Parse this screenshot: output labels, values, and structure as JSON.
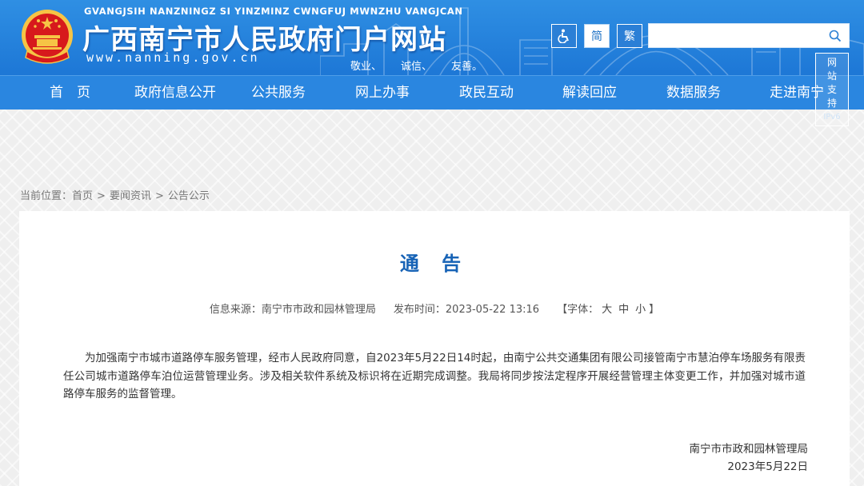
{
  "header": {
    "pinyin": "GVANGJSIH NANZNINGZ SI YINZMINZ CWNGFUJ MWNZHU VANGJCAN",
    "title": "广西南宁市人民政府门户网站",
    "url": "www.nanning.gov.cn",
    "slogan": [
      "敬业、",
      "诚信、",
      "友善。"
    ],
    "accessibility_icon": "accessibility-icon",
    "simplified_label": "简",
    "traditional_label": "繁",
    "search": {
      "value": "",
      "placeholder": "",
      "icon": "search-icon"
    },
    "ipv6_badge": [
      "网",
      "站",
      "支",
      "持",
      "IPv6"
    ]
  },
  "nav": {
    "items": [
      "首　页",
      "政府信息公开",
      "公共服务",
      "网上办事",
      "政民互动",
      "解读回应",
      "数据服务",
      "走进南宁"
    ]
  },
  "breadcrumb": {
    "prefix": "当前位置：",
    "items": [
      "首页",
      "要闻资讯",
      "公告公示"
    ],
    "separator": ">"
  },
  "article": {
    "title": "通 告",
    "source_label": "信息来源：",
    "source": "南宁市市政和园林管理局",
    "date_label": "发布时间：",
    "date": "2023-05-22 13:16",
    "fontsize_label": "【字体：",
    "fontsize_large": "大",
    "fontsize_medium": "中",
    "fontsize_small": "小",
    "fontsize_end": "】",
    "body": "为加强南宁市城市道路停车服务管理，经市人民政府同意，自2023年5月22日14时起，由南宁公共交通集团有限公司接管南宁市慧泊停车场服务有限责任公司城市道路停车泊位运营管理业务。涉及相关软件系统及标识将在近期完成调整。我局将同步按法定程序开展经营管理主体变更工作，并加强对城市道路停车服务的监督管理。",
    "signature_org": "南宁市市政和园林管理局",
    "signature_date": "2023年5月22日"
  },
  "colors": {
    "header_blue": "#2f8fe3",
    "nav_blue": "#2a86e0",
    "title_blue": "#1763b6",
    "emblem_red": "#d7191c",
    "emblem_gold": "#f6c445"
  }
}
